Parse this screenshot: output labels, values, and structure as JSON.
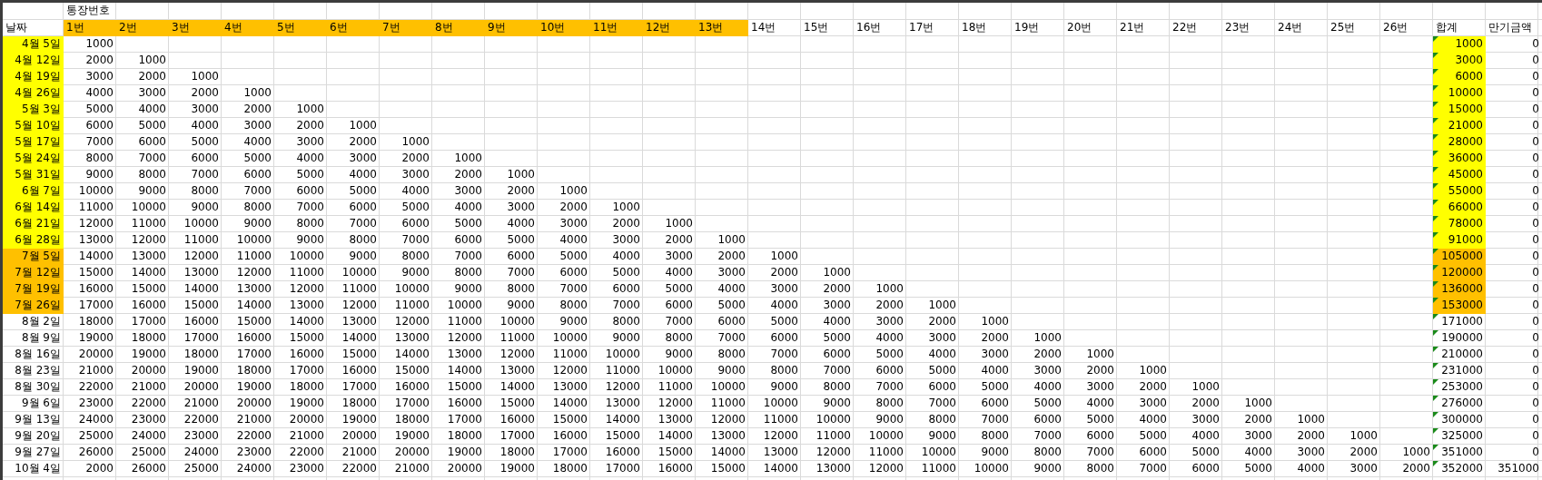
{
  "title_row": {
    "label": "통장번호"
  },
  "header": {
    "date": "날짜",
    "total": "합계",
    "maturity": "만기금액",
    "accounts": [
      {
        "label": "1번",
        "color": "#ffc000"
      },
      {
        "label": "2번",
        "color": "#ffc000"
      },
      {
        "label": "3번",
        "color": "#ffc000"
      },
      {
        "label": "4번",
        "color": "#ffc000"
      },
      {
        "label": "5번",
        "color": "#ffc000"
      },
      {
        "label": "6번",
        "color": "#ffc000"
      },
      {
        "label": "7번",
        "color": "#ffc000"
      },
      {
        "label": "8번",
        "color": "#ffc000"
      },
      {
        "label": "9번",
        "color": "#ffc000"
      },
      {
        "label": "10번",
        "color": "#ffc000"
      },
      {
        "label": "11번",
        "color": "#ffc000"
      },
      {
        "label": "12번",
        "color": "#ffc000"
      },
      {
        "label": "13번",
        "color": "#ffc000"
      },
      {
        "label": "14번"
      },
      {
        "label": "15번"
      },
      {
        "label": "16번"
      },
      {
        "label": "17번"
      },
      {
        "label": "18번"
      },
      {
        "label": "19번"
      },
      {
        "label": "20번"
      },
      {
        "label": "21번"
      },
      {
        "label": "22번"
      },
      {
        "label": "23번"
      },
      {
        "label": "24번"
      },
      {
        "label": "25번"
      },
      {
        "label": "26번"
      }
    ]
  },
  "rows": [
    {
      "date": "4월 5일",
      "color": "#ffff00",
      "values": [
        "1000"
      ],
      "total": "1000",
      "maturity": "0",
      "flagged": true
    },
    {
      "date": "4월 12일",
      "color": "#ffff00",
      "values": [
        "2000",
        "1000"
      ],
      "total": "3000",
      "maturity": "0",
      "flagged": true
    },
    {
      "date": "4월 19일",
      "color": "#ffff00",
      "values": [
        "3000",
        "2000",
        "1000"
      ],
      "total": "6000",
      "maturity": "0",
      "flagged": true
    },
    {
      "date": "4월 26일",
      "color": "#ffff00",
      "values": [
        "4000",
        "3000",
        "2000",
        "1000"
      ],
      "total": "10000",
      "maturity": "0",
      "flagged": true
    },
    {
      "date": "5월 3일",
      "color": "#ffff00",
      "values": [
        "5000",
        "4000",
        "3000",
        "2000",
        "1000"
      ],
      "total": "15000",
      "maturity": "0",
      "flagged": true
    },
    {
      "date": "5월 10일",
      "color": "#ffff00",
      "values": [
        "6000",
        "5000",
        "4000",
        "3000",
        "2000",
        "1000"
      ],
      "total": "21000",
      "maturity": "0",
      "flagged": true
    },
    {
      "date": "5월 17일",
      "color": "#ffff00",
      "values": [
        "7000",
        "6000",
        "5000",
        "4000",
        "3000",
        "2000",
        "1000"
      ],
      "total": "28000",
      "maturity": "0",
      "flagged": true
    },
    {
      "date": "5월 24일",
      "color": "#ffff00",
      "values": [
        "8000",
        "7000",
        "6000",
        "5000",
        "4000",
        "3000",
        "2000",
        "1000"
      ],
      "total": "36000",
      "maturity": "0",
      "flagged": true
    },
    {
      "date": "5월 31일",
      "color": "#ffff00",
      "values": [
        "9000",
        "8000",
        "7000",
        "6000",
        "5000",
        "4000",
        "3000",
        "2000",
        "1000"
      ],
      "total": "45000",
      "maturity": "0",
      "flagged": true
    },
    {
      "date": "6월 7일",
      "color": "#ffff00",
      "values": [
        "10000",
        "9000",
        "8000",
        "7000",
        "6000",
        "5000",
        "4000",
        "3000",
        "2000",
        "1000"
      ],
      "total": "55000",
      "maturity": "0",
      "flagged": true
    },
    {
      "date": "6월 14일",
      "color": "#ffff00",
      "values": [
        "11000",
        "10000",
        "9000",
        "8000",
        "7000",
        "6000",
        "5000",
        "4000",
        "3000",
        "2000",
        "1000"
      ],
      "total": "66000",
      "maturity": "0",
      "flagged": true
    },
    {
      "date": "6월 21일",
      "color": "#ffff00",
      "values": [
        "12000",
        "11000",
        "10000",
        "9000",
        "8000",
        "7000",
        "6000",
        "5000",
        "4000",
        "3000",
        "2000",
        "1000"
      ],
      "total": "78000",
      "maturity": "0",
      "flagged": true
    },
    {
      "date": "6월 28일",
      "color": "#ffff00",
      "values": [
        "13000",
        "12000",
        "11000",
        "10000",
        "9000",
        "8000",
        "7000",
        "6000",
        "5000",
        "4000",
        "3000",
        "2000",
        "1000"
      ],
      "total": "91000",
      "maturity": "0",
      "flagged": true
    },
    {
      "date": "7월 5일",
      "color": "#ffc000",
      "values": [
        "14000",
        "13000",
        "12000",
        "11000",
        "10000",
        "9000",
        "8000",
        "7000",
        "6000",
        "5000",
        "4000",
        "3000",
        "2000",
        "1000"
      ],
      "total": "105000",
      "maturity": "0",
      "flagged": true
    },
    {
      "date": "7월 12일",
      "color": "#ffc000",
      "values": [
        "15000",
        "14000",
        "13000",
        "12000",
        "11000",
        "10000",
        "9000",
        "8000",
        "7000",
        "6000",
        "5000",
        "4000",
        "3000",
        "2000",
        "1000"
      ],
      "total": "120000",
      "maturity": "0",
      "flagged": true
    },
    {
      "date": "7월 19일",
      "color": "#ffc000",
      "values": [
        "16000",
        "15000",
        "14000",
        "13000",
        "12000",
        "11000",
        "10000",
        "9000",
        "8000",
        "7000",
        "6000",
        "5000",
        "4000",
        "3000",
        "2000",
        "1000"
      ],
      "total": "136000",
      "maturity": "0",
      "flagged": true
    },
    {
      "date": "7월 26일",
      "color": "#ffc000",
      "values": [
        "17000",
        "16000",
        "15000",
        "14000",
        "13000",
        "12000",
        "11000",
        "10000",
        "9000",
        "8000",
        "7000",
        "6000",
        "5000",
        "4000",
        "3000",
        "2000",
        "1000"
      ],
      "total": "153000",
      "maturity": "0",
      "flagged": true
    },
    {
      "date": "8월 2일",
      "values": [
        "18000",
        "17000",
        "16000",
        "15000",
        "14000",
        "13000",
        "12000",
        "11000",
        "10000",
        "9000",
        "8000",
        "7000",
        "6000",
        "5000",
        "4000",
        "3000",
        "2000",
        "1000"
      ],
      "total": "171000",
      "maturity": "0",
      "flagged": true
    },
    {
      "date": "8월 9일",
      "values": [
        "19000",
        "18000",
        "17000",
        "16000",
        "15000",
        "14000",
        "13000",
        "12000",
        "11000",
        "10000",
        "9000",
        "8000",
        "7000",
        "6000",
        "5000",
        "4000",
        "3000",
        "2000",
        "1000"
      ],
      "total": "190000",
      "maturity": "0",
      "flagged": true
    },
    {
      "date": "8월 16일",
      "values": [
        "20000",
        "19000",
        "18000",
        "17000",
        "16000",
        "15000",
        "14000",
        "13000",
        "12000",
        "11000",
        "10000",
        "9000",
        "8000",
        "7000",
        "6000",
        "5000",
        "4000",
        "3000",
        "2000",
        "1000"
      ],
      "total": "210000",
      "maturity": "0",
      "flagged": true
    },
    {
      "date": "8월 23일",
      "values": [
        "21000",
        "20000",
        "19000",
        "18000",
        "17000",
        "16000",
        "15000",
        "14000",
        "13000",
        "12000",
        "11000",
        "10000",
        "9000",
        "8000",
        "7000",
        "6000",
        "5000",
        "4000",
        "3000",
        "2000",
        "1000"
      ],
      "total": "231000",
      "maturity": "0",
      "flagged": true
    },
    {
      "date": "8월 30일",
      "values": [
        "22000",
        "21000",
        "20000",
        "19000",
        "18000",
        "17000",
        "16000",
        "15000",
        "14000",
        "13000",
        "12000",
        "11000",
        "10000",
        "9000",
        "8000",
        "7000",
        "6000",
        "5000",
        "4000",
        "3000",
        "2000",
        "1000"
      ],
      "total": "253000",
      "maturity": "0",
      "flagged": true
    },
    {
      "date": "9월 6일",
      "values": [
        "23000",
        "22000",
        "21000",
        "20000",
        "19000",
        "18000",
        "17000",
        "16000",
        "15000",
        "14000",
        "13000",
        "12000",
        "11000",
        "10000",
        "9000",
        "8000",
        "7000",
        "6000",
        "5000",
        "4000",
        "3000",
        "2000",
        "1000"
      ],
      "total": "276000",
      "maturity": "0",
      "flagged": true
    },
    {
      "date": "9월 13일",
      "values": [
        "24000",
        "23000",
        "22000",
        "21000",
        "20000",
        "19000",
        "18000",
        "17000",
        "16000",
        "15000",
        "14000",
        "13000",
        "12000",
        "11000",
        "10000",
        "9000",
        "8000",
        "7000",
        "6000",
        "5000",
        "4000",
        "3000",
        "2000",
        "1000"
      ],
      "total": "300000",
      "maturity": "0",
      "flagged": true
    },
    {
      "date": "9월 20일",
      "values": [
        "25000",
        "24000",
        "23000",
        "22000",
        "21000",
        "20000",
        "19000",
        "18000",
        "17000",
        "16000",
        "15000",
        "14000",
        "13000",
        "12000",
        "11000",
        "10000",
        "9000",
        "8000",
        "7000",
        "6000",
        "5000",
        "4000",
        "3000",
        "2000",
        "1000"
      ],
      "total": "325000",
      "maturity": "0",
      "flagged": true
    },
    {
      "date": "9월 27일",
      "values": [
        "26000",
        "25000",
        "24000",
        "23000",
        "22000",
        "21000",
        "20000",
        "19000",
        "18000",
        "17000",
        "16000",
        "15000",
        "14000",
        "13000",
        "12000",
        "11000",
        "10000",
        "9000",
        "8000",
        "7000",
        "6000",
        "5000",
        "4000",
        "3000",
        "2000",
        "1000"
      ],
      "total": "351000",
      "maturity": "0",
      "flagged": true
    },
    {
      "date": "10월 4일",
      "values": [
        "2000",
        "26000",
        "25000",
        "24000",
        "23000",
        "22000",
        "21000",
        "20000",
        "19000",
        "18000",
        "17000",
        "16000",
        "15000",
        "14000",
        "13000",
        "12000",
        "11000",
        "10000",
        "9000",
        "8000",
        "7000",
        "6000",
        "5000",
        "4000",
        "3000",
        "2000"
      ],
      "total": "352000",
      "maturity": "351000",
      "flagged": true
    }
  ]
}
